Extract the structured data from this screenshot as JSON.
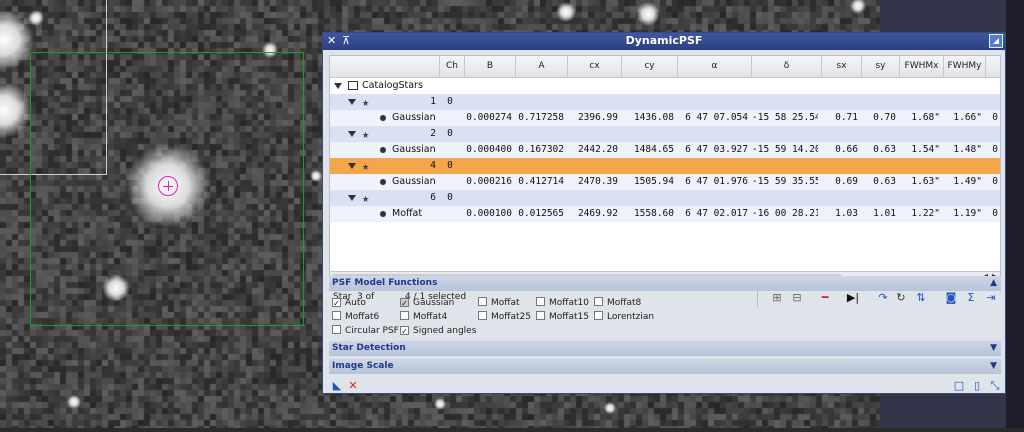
{
  "window": {
    "title": "DynamicPSF",
    "close_icon": "close-icon",
    "shade_icon": "shade-icon"
  },
  "table": {
    "columns": [
      "Ch",
      "B",
      "A",
      "cx",
      "cy",
      "α",
      "δ",
      "sx",
      "sy",
      "FWHMx",
      "FWHMy"
    ],
    "root_label": "CatalogStars",
    "groups": [
      {
        "star": "1",
        "ch": "0",
        "selected": false,
        "fit": {
          "func": "Gaussian",
          "B": "0.000274",
          "A": "0.717258",
          "cx": "2396.99",
          "cy": "1436.08",
          "alpha": "6 47 07.054",
          "delta": "-15 58 25.54",
          "sx": "0.71",
          "sy": "0.70",
          "fwhmx": "1.68\"",
          "fwhmy": "1.66\"",
          "more": "0"
        }
      },
      {
        "star": "2",
        "ch": "0",
        "selected": false,
        "fit": {
          "func": "Gaussian",
          "B": "0.000400",
          "A": "0.167302",
          "cx": "2442.20",
          "cy": "1484.65",
          "alpha": "6 47 03.927",
          "delta": "-15 59 14.20",
          "sx": "0.66",
          "sy": "0.63",
          "fwhmx": "1.54\"",
          "fwhmy": "1.48\"",
          "more": "0"
        }
      },
      {
        "star": "4",
        "ch": "0",
        "selected": true,
        "fit": {
          "func": "Gaussian",
          "B": "0.000216",
          "A": "0.412714",
          "cx": "2470.39",
          "cy": "1505.94",
          "alpha": "6 47 01.976",
          "delta": "-15 59 35.55",
          "sx": "0.69",
          "sy": "0.63",
          "fwhmx": "1.63\"",
          "fwhmy": "1.49\"",
          "more": "0"
        }
      },
      {
        "star": "6",
        "ch": "0",
        "selected": false,
        "fit": {
          "func": "Moffat",
          "B": "0.000100",
          "A": "0.012565",
          "cx": "2469.92",
          "cy": "1558.60",
          "alpha": "6 47 02.017",
          "delta": "-16 00 28.21",
          "sx": "1.03",
          "sy": "1.01",
          "fwhmx": "1.22\"",
          "fwhmy": "1.19\"",
          "more": "0"
        }
      }
    ]
  },
  "status": {
    "star_label": "Star",
    "position": "3 of",
    "selection": "4 / 1 selected"
  },
  "toolbar_icons": [
    "expand-all-icon",
    "collapse-all-icon",
    "delete-icon",
    "next-icon",
    "redo-icon",
    "refresh-icon",
    "sort-icon",
    "camera-icon",
    "sum-icon",
    "export-icon"
  ],
  "sections": {
    "psf": "PSF Model Functions",
    "star_detection": "Star Detection",
    "image_scale": "Image Scale"
  },
  "psf_options": [
    {
      "label": "Auto",
      "checked": true,
      "disabled": false
    },
    {
      "label": "Gaussian",
      "checked": true,
      "disabled": true
    },
    {
      "label": "Moffat",
      "checked": false,
      "disabled": false
    },
    {
      "label": "Moffat10",
      "checked": false,
      "disabled": false
    },
    {
      "label": "Moffat8",
      "checked": false,
      "disabled": false
    },
    {
      "label": "Moffat6",
      "checked": false,
      "disabled": false
    },
    {
      "label": "Moffat4",
      "checked": false,
      "disabled": false
    },
    {
      "label": "Moffat25",
      "checked": false,
      "disabled": false
    },
    {
      "label": "Moffat15",
      "checked": false,
      "disabled": false
    },
    {
      "label": "Lorentzian",
      "checked": false,
      "disabled": false
    },
    {
      "label": "Circular PSF",
      "checked": false,
      "disabled": false
    },
    {
      "label": "Signed angles",
      "checked": true,
      "disabled": false
    }
  ],
  "colors": {
    "accent": "#2c3f82",
    "selected_row": "#f5a54a",
    "section_text": "#1e3a8a",
    "green_box": "#1f9a2a",
    "crosshair": "#e020c0"
  }
}
